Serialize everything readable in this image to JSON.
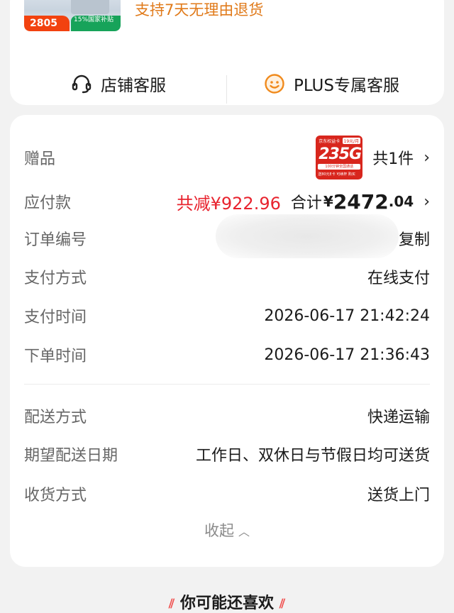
{
  "product": {
    "thumb_red_tag": "2805",
    "thumb_green_tag": "15%国家补贴",
    "return_policy": "支持7天无理由退货"
  },
  "service": {
    "shop_label": "店铺客服",
    "plus_label": "PLUS专属客服"
  },
  "order": {
    "gift_label": "赠品",
    "gift_image_text": "235G",
    "gift_count": "共1件",
    "payable_label": "应付款",
    "discount": "共减¥922.96",
    "total_label": "合计",
    "total_yen": "¥",
    "total_int": "2472",
    "total_dec": ".04",
    "order_no_label": "订单编号",
    "copy_label": "复制",
    "pay_method_label": "支付方式",
    "pay_method_value": "在线支付",
    "pay_time_label": "支付时间",
    "pay_time_value": "2026-06-17 21:42:24",
    "order_time_label": "下单时间",
    "order_time_value": "2026-06-17 21:36:43",
    "delivery_method_label": "配送方式",
    "delivery_method_value": "快递运输",
    "delivery_date_label": "期望配送日期",
    "delivery_date_value": "工作日、双休日与节假日均可送货",
    "receive_method_label": "收货方式",
    "receive_method_value": "送货上门",
    "collapse_label": "收起"
  },
  "recommend": {
    "title": "你可能还喜欢"
  },
  "colors": {
    "accent_red": "#e8232e",
    "orange": "#e07a1a",
    "background": "#f2f2f2"
  }
}
